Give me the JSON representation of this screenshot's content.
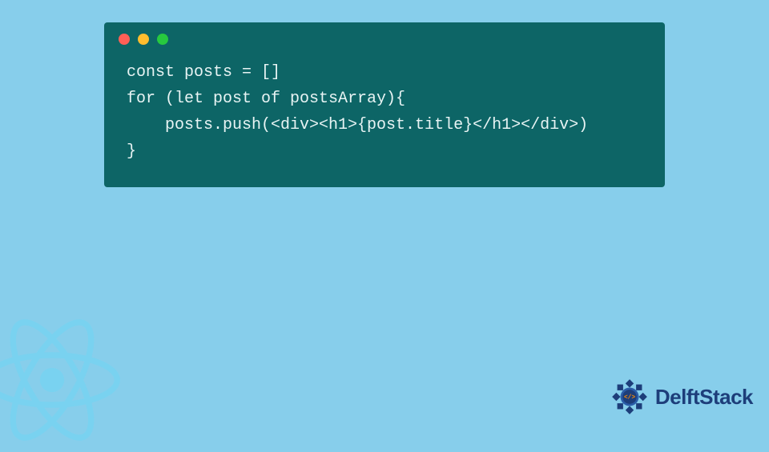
{
  "code": {
    "line1": "const posts = []",
    "line2": "for (let post of postsArray){",
    "line3": "    posts.push(<div><h1>{post.title}</h1></div>)",
    "line4": "}"
  },
  "branding": {
    "name": "DelftStack"
  }
}
